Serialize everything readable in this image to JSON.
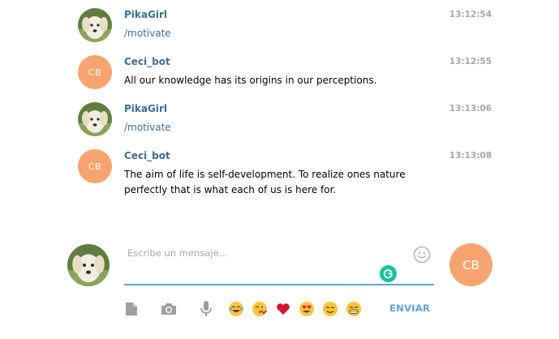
{
  "messages": [
    {
      "author": "PikaGirl",
      "time": "13:12:54",
      "text": "/motivate",
      "avatar_type": "dog-photo",
      "is_command": true
    },
    {
      "author": "Ceci_bot",
      "time": "13:12:55",
      "text": "All our knowledge has its origins in our perceptions.",
      "avatar_type": "initials",
      "initials": "CB",
      "is_command": false
    },
    {
      "author": "PikaGirl",
      "time": "13:13:06",
      "text": "/motivate",
      "avatar_type": "dog-photo",
      "is_command": true
    },
    {
      "author": "Ceci_bot",
      "time": "13:13:08",
      "text": "The aim of life is self-development. To realize ones nature perfectly that is what each of us is here for.",
      "avatar_type": "initials",
      "initials": "CB",
      "is_command": false
    }
  ],
  "composer": {
    "placeholder": "Escribe un mensaje...",
    "value": "",
    "peer_initials": "CB",
    "send_label": "ENVIAR",
    "toolbar": [
      "document-icon",
      "camera-icon",
      "microphone-icon"
    ],
    "emojis": [
      "joy-emoji",
      "kiss-emoji",
      "heart-emoji",
      "heart-eyes-emoji",
      "smile-emoji",
      "grin-emoji"
    ]
  },
  "colors": {
    "author": "#3a6d99",
    "timestamp": "#a6a6a6",
    "bot_avatar": "#f8a470",
    "accent": "#5fa3dc",
    "grammarly": "#15c39a"
  }
}
